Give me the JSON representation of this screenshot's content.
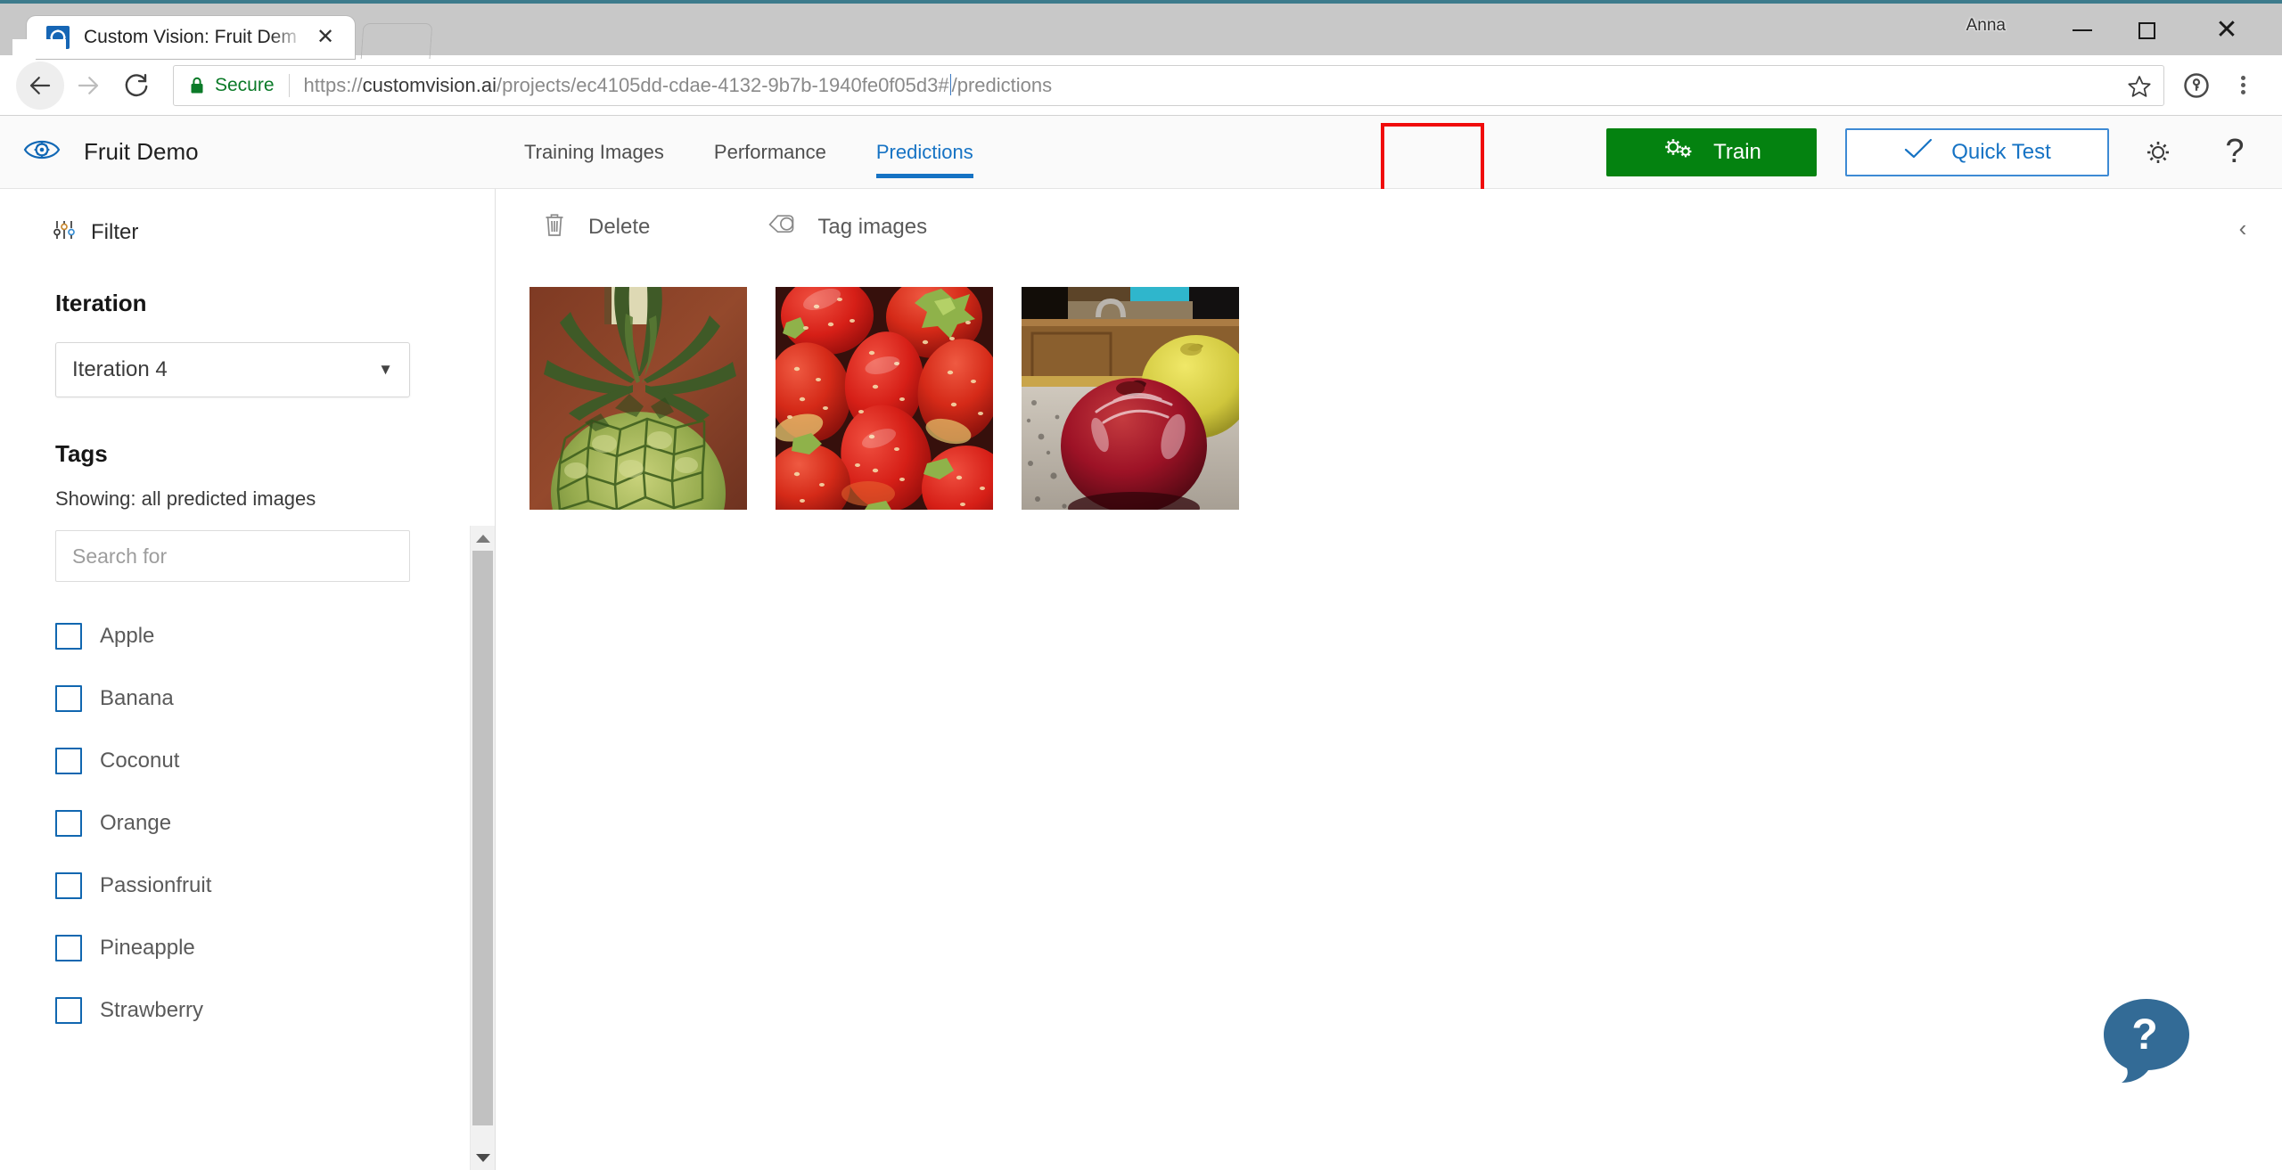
{
  "window": {
    "user_label": "Anna",
    "minimize_icon": "minimize-icon",
    "maximize_icon": "maximize-icon",
    "close_glyph": "✕"
  },
  "tab": {
    "title": "Custom Vision: Fruit Dem",
    "close_glyph": "✕",
    "favicon": "custom-vision-favicon"
  },
  "browser": {
    "back_icon": "back-arrow-icon",
    "forward_icon": "forward-arrow-icon",
    "reload_icon": "reload-icon",
    "security_label": "Secure",
    "url_prefix": "https://",
    "url_host": "customvision.ai",
    "url_path": "/projects/ec4105dd-cdae-4132-9b7b-1940fe0f05d3#",
    "url_suffix": "/predictions",
    "url_full": "https://customvision.ai/projects/ec4105dd-cdae-4132-9b7b-1940fe0f05d3#/predictions",
    "star_icon": "bookmark-star-icon",
    "extension_icon": "password-extension-icon",
    "menu_icon": "three-dot-menu-icon"
  },
  "app_header": {
    "logo_icon": "custom-vision-eye-gear-logo",
    "project_title": "Fruit Demo",
    "tabs": [
      {
        "label": "Training Images",
        "active": false
      },
      {
        "label": "Performance",
        "active": false
      },
      {
        "label": "Predictions",
        "active": true
      }
    ],
    "train_button": {
      "label": "Train",
      "icon": "gears-icon",
      "color": "#048210"
    },
    "quick_test_button": {
      "label": "Quick Test",
      "icon": "checkmark-icon",
      "color": "#1673c4"
    },
    "settings_icon": "gear-icon",
    "help_icon": "question-mark-icon",
    "highlight_color": "#f00b0b",
    "active_tab_color": "#1673c4"
  },
  "sidebar": {
    "filter_label": "Filter",
    "filter_icon": "sliders-filter-icon",
    "iteration_heading": "Iteration",
    "iteration_selected": "Iteration 4",
    "iteration_caret": "▼",
    "tags_heading": "Tags",
    "showing_text": "Showing: all predicted images",
    "search_placeholder": "Search for",
    "search_value": "",
    "tags": [
      {
        "label": "Apple",
        "checked": false
      },
      {
        "label": "Banana",
        "checked": false
      },
      {
        "label": "Coconut",
        "checked": false
      },
      {
        "label": "Orange",
        "checked": false
      },
      {
        "label": "Passionfruit",
        "checked": false
      },
      {
        "label": "Pineapple",
        "checked": false
      },
      {
        "label": "Strawberry",
        "checked": false
      }
    ],
    "checkbox_color": "#1167b0"
  },
  "main": {
    "delete_label": "Delete",
    "delete_icon": "trash-icon",
    "tag_images_label": "Tag images",
    "tag_images_icon": "tag-icon",
    "collapse_icon": "chevron-left-icon",
    "collapse_glyph": "‹",
    "images": [
      {
        "alt": "pineapple",
        "name": "prediction-thumbnail-pineapple"
      },
      {
        "alt": "strawberries",
        "name": "prediction-thumbnail-strawberries"
      },
      {
        "alt": "red apple on counter",
        "name": "prediction-thumbnail-apple"
      }
    ]
  },
  "help_bubble": {
    "glyph": "?",
    "icon": "help-chat-bubble-icon",
    "color": "#336b96"
  }
}
